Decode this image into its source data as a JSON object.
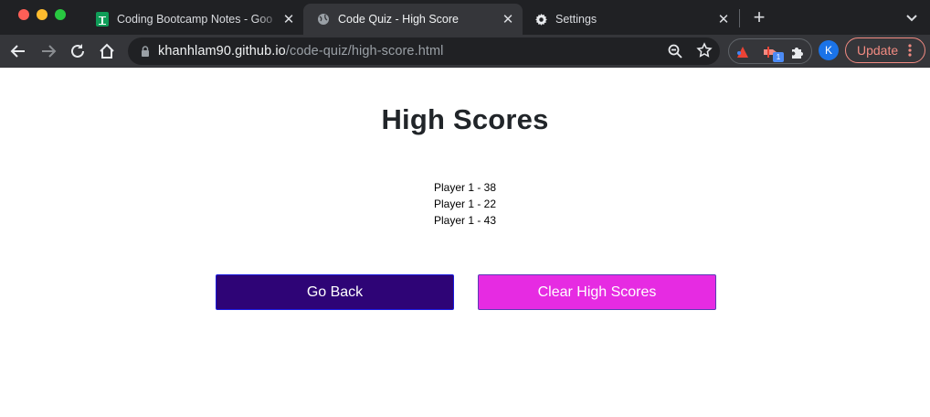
{
  "browser": {
    "tabs": [
      {
        "title": "Coding Bootcamp Notes - Goo",
        "icon": "google-sheets-icon",
        "active": false
      },
      {
        "title": "Code Quiz - High Score",
        "icon": "globe-icon",
        "active": true
      },
      {
        "title": "Settings",
        "icon": "gear-icon",
        "active": false
      }
    ],
    "url_host": "khanhlam90.github.io",
    "url_path": "/code-quiz/high-score.html",
    "profile_initial": "K",
    "update_label": "Update",
    "extension_badge": "1",
    "colors": {
      "tab_strip": "#202124",
      "toolbar": "#35363a",
      "update_accent": "#f28b82",
      "avatar": "#1a73e8"
    }
  },
  "page": {
    "title": "High Scores",
    "scores": [
      "Player 1 - 38",
      "Player 1 - 22",
      "Player 1 - 43"
    ],
    "go_back_label": "Go Back",
    "clear_label": "Clear High Scores",
    "colors": {
      "go_back_bg": "#2e0476",
      "clear_bg": "#e62be2",
      "title_text": "#212529"
    }
  }
}
